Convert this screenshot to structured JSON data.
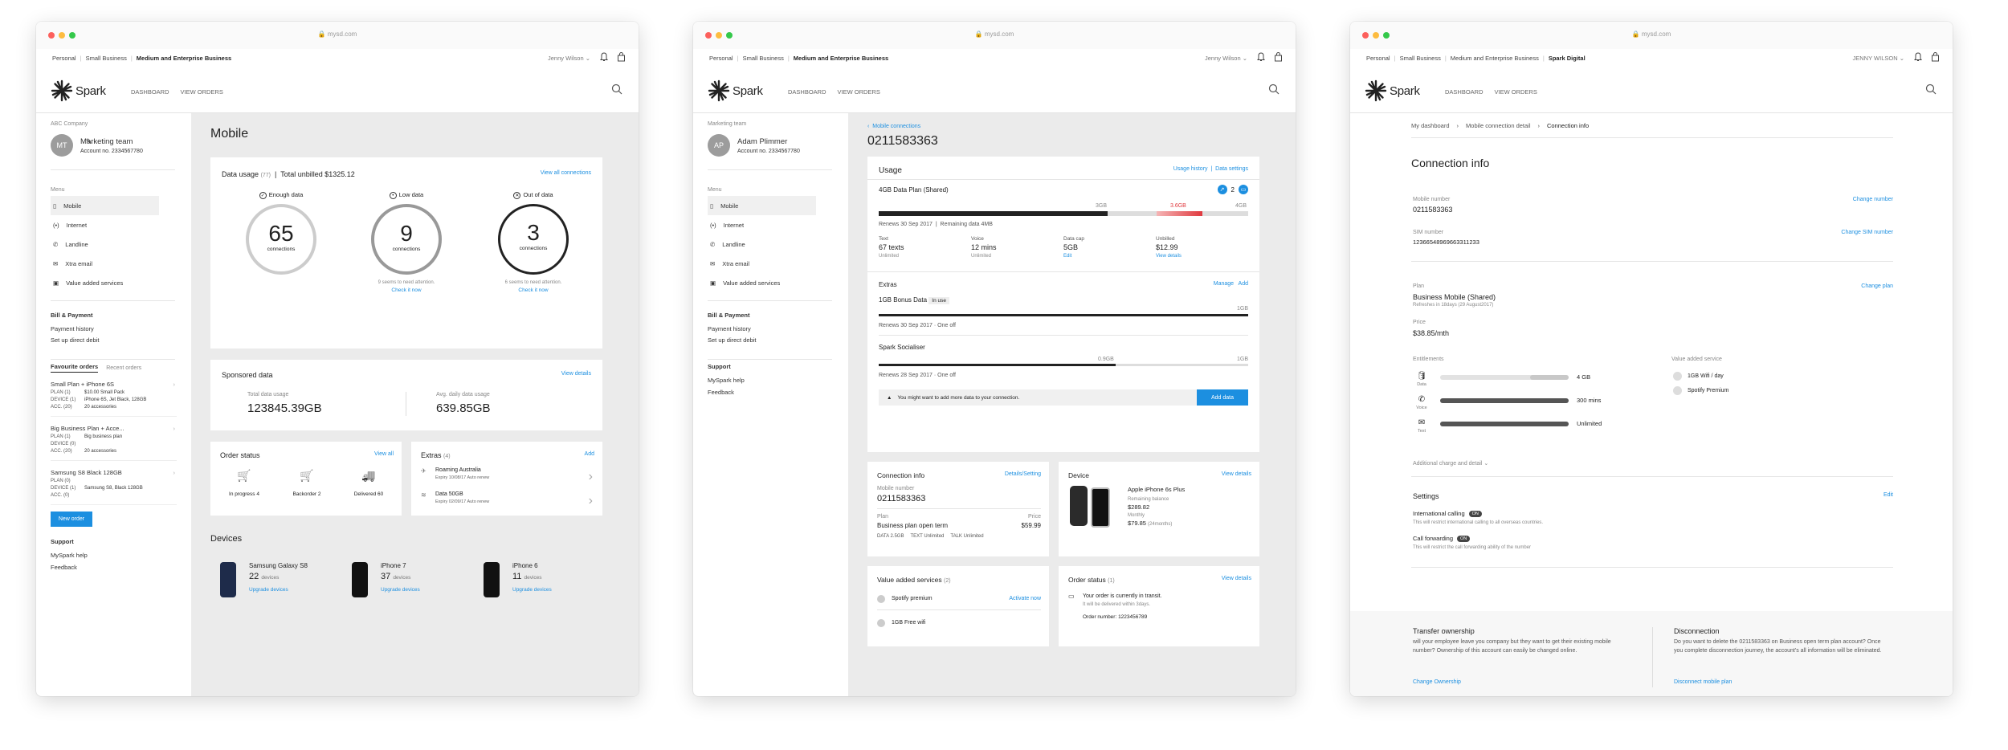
{
  "domain_url": "mysd.com",
  "s1": {
    "crumbs": [
      "Personal",
      "Small Business",
      "Medium and Enterprise Business"
    ],
    "user": "Jenny Wilson",
    "nav": [
      "DASHBOARD",
      "VIEW ORDERS"
    ],
    "logo": "Spark",
    "company": "ABC Company",
    "avatar": "MT",
    "team": "Marketing team",
    "account": "Account no. 2334567780",
    "menu_title": "Menu",
    "menu": [
      "Mobile",
      "Internet",
      "Landline",
      "Xtra email",
      "Value added services"
    ],
    "bill": "Bill & Payment",
    "bill_items": [
      "Payment history",
      "Set up direct debit"
    ],
    "fav_tab": "Favourite orders",
    "recent_tab": "Recent orders",
    "orders": [
      {
        "title": "Small Plan + iPhone 6S",
        "lines": [
          [
            "PLAN (1)",
            "$10.00 Small Pack"
          ],
          [
            "DEVICE (1)",
            "iPhone 6S, Jet Black, 128GB"
          ],
          [
            "ACC. (20)",
            "20 accessories"
          ]
        ]
      },
      {
        "title": "Big Business Plan + Acce...",
        "lines": [
          [
            "PLAN (1)",
            "Big business plan"
          ],
          [
            "DEVICE (0)",
            ""
          ],
          [
            "ACC. (20)",
            "20 accessories"
          ]
        ]
      },
      {
        "title": "Samsung S8 Black 128GB",
        "lines": [
          [
            "PLAN (0)",
            ""
          ],
          [
            "DEVICE (1)",
            "Samsung S8, Black 128GB"
          ],
          [
            "ACC. (0)",
            ""
          ]
        ]
      }
    ],
    "new_order": "New order",
    "support": "Support",
    "support_items": [
      "MySpark help",
      "Feedback"
    ],
    "page_title": "Mobile",
    "usage_title": "Data usage",
    "usage_count": "(77)",
    "unbilled_label": "Total unbilled",
    "unbilled": "$1325.12",
    "view_all_conn": "View all connections",
    "states": [
      {
        "label": "Enough data",
        "num": "65",
        "unit": "connections",
        "note": "",
        "link": ""
      },
      {
        "label": "Low data",
        "num": "9",
        "unit": "connections",
        "note": "9 seems to need attention.",
        "link": "Check it now"
      },
      {
        "label": "Out of data",
        "num": "3",
        "unit": "connections",
        "note": "6 seems to need attention.",
        "link": "Check it now"
      }
    ],
    "sponsored_title": "Sponsored data",
    "view_details": "View details",
    "total_label": "Total data usage",
    "total_val": "123845.39GB",
    "avg_label": "Avg. daily data usage",
    "avg_val": "639.85GB",
    "order_status": "Order status",
    "view_all": "View all",
    "status_items": [
      [
        "In progress",
        "4"
      ],
      [
        "Backorder",
        "2"
      ],
      [
        "Delivered",
        "60"
      ]
    ],
    "extras": "Extras",
    "extras_count": "(4)",
    "add": "Add",
    "extra_items": [
      {
        "t": "Roaming",
        "t2": "Australia",
        "s": "Expiry 10/08/17",
        "s2": "Auto renew"
      },
      {
        "t": "Data 50GB",
        "t2": "",
        "s": "Expiry 02/09/17",
        "s2": "Auto renew"
      }
    ],
    "devices_title": "Devices",
    "devices": [
      {
        "name": "Samsung Galaxy S8",
        "n": "22",
        "u": "devices",
        "l": "Upgrade devices"
      },
      {
        "name": "iPhone 7",
        "n": "37",
        "u": "devices",
        "l": "Upgrade devices"
      },
      {
        "name": "iPhone 6",
        "n": "11",
        "u": "devices",
        "l": "Upgrade devices"
      }
    ]
  },
  "s2": {
    "crumbs": [
      "Personal",
      "Small Business",
      "Medium and Enterprise Business"
    ],
    "user": "Jenny Wilson",
    "nav": [
      "DASHBOARD",
      "VIEW ORDERS"
    ],
    "team": "Marketing team",
    "avatar": "AP",
    "name": "Adam Plimmer",
    "account": "Account no. 2334567780",
    "menu_title": "Menu",
    "menu": [
      "Mobile",
      "Internet",
      "Landline",
      "Xtra email",
      "Value added services"
    ],
    "bill": "Bill & Payment",
    "bill_items": [
      "Payment history",
      "Set up direct debit"
    ],
    "support": "Support",
    "support_items": [
      "MySpark help",
      "Feedback"
    ],
    "back": "Mobile connections",
    "number": "0211583363",
    "usage": "Usage",
    "usage_history": "Usage history",
    "data_settings": "Data settings",
    "plan": "4GB Data Plan (Shared)",
    "badge_n": "2",
    "ticks": [
      "3GB",
      "3.6GB",
      "4GB"
    ],
    "renews": "Renews 30 Sep 2017",
    "remaining": "Remaining data 4MB",
    "stats": [
      {
        "l": "Text",
        "v": "67 texts",
        "s": "Unlimited"
      },
      {
        "l": "Voice",
        "v": "12 mins",
        "s": "Unlimited"
      },
      {
        "l": "Data cap",
        "v": "5GB",
        "s": "Edit"
      },
      {
        "l": "Unbilled",
        "v": "$12.99",
        "s": "View details"
      }
    ],
    "extras": "Extras",
    "manage": "Manage",
    "add": "Add",
    "bonus": "1GB Bonus Data",
    "inuse": "In use",
    "bonus_tick": "1GB",
    "bonus_renew": "Renews 30 Sep 2017",
    "oneoff": "One off",
    "social": "Spark Socialiser",
    "social_ticks": [
      "0.9GB",
      "1GB"
    ],
    "social_renew": "Renews 28 Sep 2017",
    "warn": "You might want to add more data to your connection.",
    "add_data": "Add data",
    "conn_info": "Connection info",
    "details_settings": "Details/Setting",
    "mobile_label": "Mobile number",
    "plan_label": "Plan",
    "plan_name": "Business plan open term",
    "price_label": "Price",
    "price": "$59.99",
    "plan_bits": [
      "DATA 2.5GB",
      "TEXT Unlimited",
      "TALK Unlimited"
    ],
    "device": "Device",
    "view_details": "View details",
    "phone": "Apple iPhone 6s Plus",
    "rem_label": "Remaining balance",
    "rem": "$289.82",
    "monthly_label": "Monthly",
    "monthly": "$79.85",
    "monthly_note": "(24months)",
    "vas": "Value added services",
    "vas_n": "(2)",
    "vas_items": [
      {
        "t": "Spotify premium",
        "a": "Activate now"
      },
      {
        "t": "1GB Free wifi",
        "a": ""
      }
    ],
    "os": "Order status",
    "os_n": "(1)",
    "os_msg": "Your order is currently in transit.",
    "os_sub": "It will be delivered within 3days.",
    "os_num": "Order number: 1223456789"
  },
  "s3": {
    "crumbs": [
      "Personal",
      "Small Business",
      "Medium and Enterprise Business",
      "Spark Digital"
    ],
    "user": "JENNY WILSON",
    "nav": [
      "DASHBOARD",
      "VIEW ORDERS"
    ],
    "bc": [
      "My dashboard",
      "Mobile connection detail",
      "Connection info"
    ],
    "title": "Connection info",
    "mobile_label": "Mobile number",
    "mobile": "0211583363",
    "change_number": "Change number",
    "sim_label": "SIM number",
    "sim": "12366548969663311233",
    "change_sim": "Change SIM number",
    "plan_label": "Plan",
    "plan": "Business Mobile (Shared)",
    "refresh": "Refreshes in 18days (29 August2017)",
    "change_plan": "Change plan",
    "price_label": "Price",
    "price": "$38.85/mth",
    "ent": "Entitlements",
    "ents": [
      {
        "i": "Data",
        "v": "4 GB"
      },
      {
        "i": "Voice",
        "v": "300 mins"
      },
      {
        "i": "Text",
        "v": "Unlimited"
      }
    ],
    "vas": "Value added service",
    "vas_items": [
      "1GB Wifi / day",
      "Spotify Premium"
    ],
    "additional": "Additional charge and detail",
    "settings": "Settings",
    "edit": "Edit",
    "intl": "International calling",
    "intl_state": "ON",
    "intl_desc": "This will restrict international calling to all overseas countries.",
    "fwd": "Call forwarding",
    "fwd_state": "ON",
    "fwd_desc": "This will restrict the call forwarding ability of the number",
    "transfer": "Transfer ownership",
    "transfer_desc": "will your employee leave you company but they want to get their existing mobile number? Ownership of this account can easily be changed online.",
    "change_own": "Change Ownership",
    "disc": "Disconnection",
    "disc_desc": "Do you want to delete the 0211583363 on Business open term plan account? Once you complete disconnection journey, the account's all information will be eliminated.",
    "disc_link": "Disconnect mobile plan"
  },
  "colors": {
    "accent": "#1c8fe0",
    "red": "#e0393e"
  }
}
